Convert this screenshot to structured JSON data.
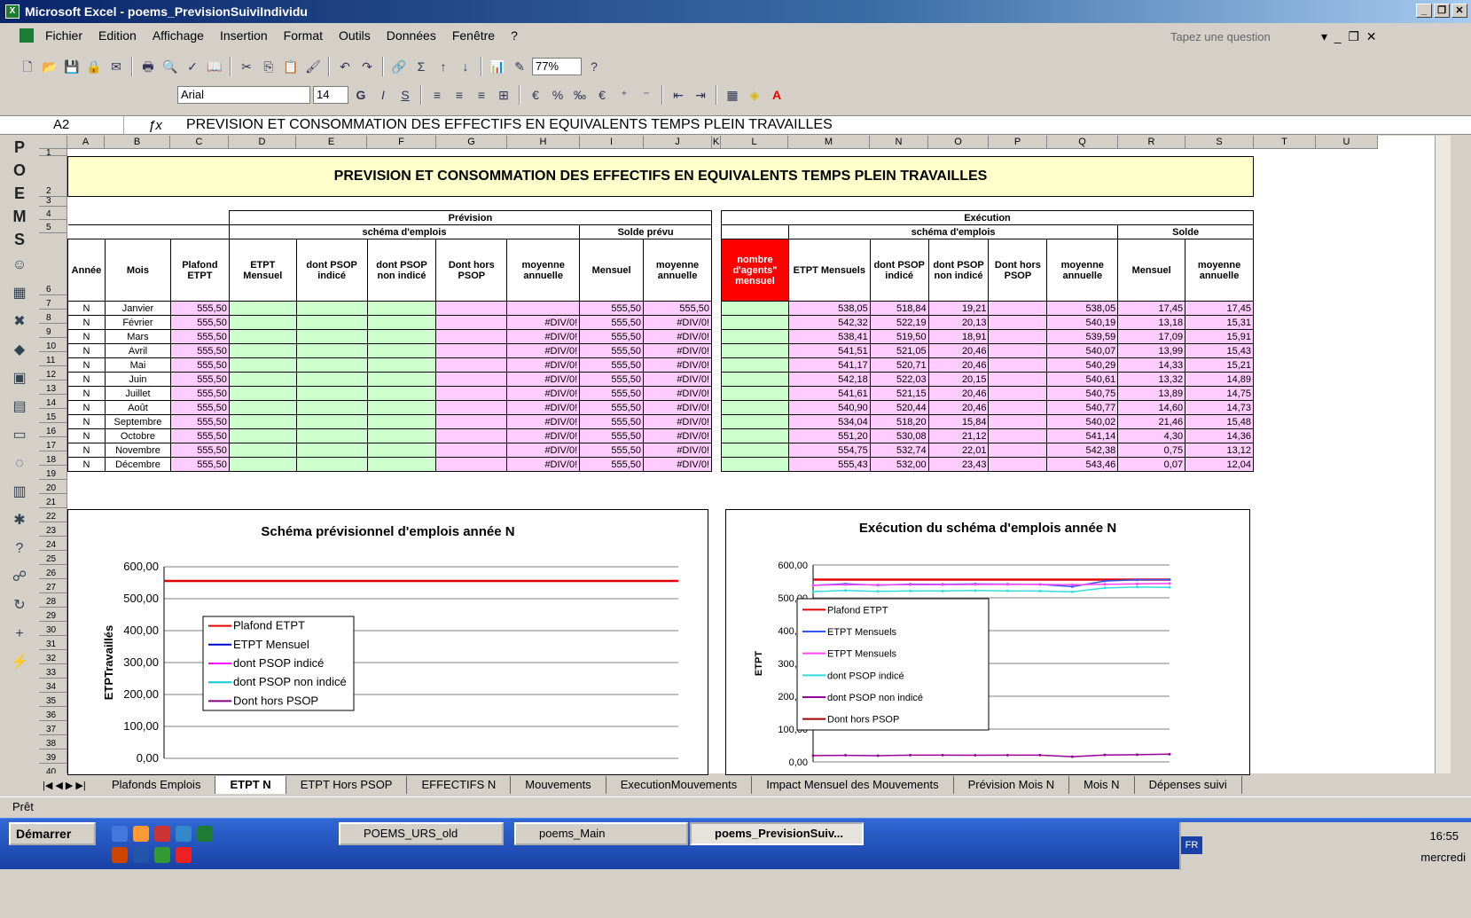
{
  "window": {
    "title": "Microsoft Excel - poems_PrevisionSuiviIndividu",
    "controls": [
      "_",
      "̆",
      "X"
    ]
  },
  "menubar": {
    "items": [
      "Fichier",
      "Edition",
      "Affichage",
      "Insertion",
      "Format",
      "Outils",
      "Données",
      "Fenêtre",
      "?"
    ],
    "help_placeholder": "Tapez une question"
  },
  "toolbar": {
    "zoom": "77%",
    "font": "Arial",
    "font_size": "14"
  },
  "formula_bar": {
    "cell_ref": "A2",
    "fx": "fx",
    "formula": "PREVISION ET CONSOMMATION DES EFFECTIFS EN EQUIVALENTS TEMPS PLEIN TRAVAILLES"
  },
  "sidebar": {
    "letters": [
      "P",
      "O",
      "E",
      "M",
      "S"
    ],
    "icons": [
      "smiley-icon",
      "table-icon",
      "tools-icon",
      "fox-icon",
      "save-icon",
      "save-as-icon",
      "window-icon",
      "search-icon",
      "calendar-icon",
      "settings-icon",
      "help-icon",
      "users-icon",
      "refresh-icon",
      "add-icon",
      "lightning-icon"
    ]
  },
  "columns": [
    "A",
    "B",
    "C",
    "D",
    "E",
    "F",
    "G",
    "H",
    "I",
    "J",
    "K",
    "L",
    "M",
    "N",
    "O",
    "P",
    "Q",
    "R",
    "S",
    "T",
    "U"
  ],
  "rows": [
    "1",
    "2",
    "3",
    "4",
    "5",
    "6",
    "7",
    "8",
    "9",
    "10",
    "11",
    "12",
    "13",
    "14",
    "15",
    "16",
    "17",
    "18",
    "19",
    "20",
    "21",
    "22",
    "23",
    "24",
    "25",
    "26",
    "27",
    "28",
    "29",
    "30",
    "31",
    "32",
    "33",
    "34",
    "35",
    "36",
    "37",
    "38",
    "39",
    "40"
  ],
  "sheet": {
    "title": "PREVISION ET CONSOMMATION DES EFFECTIFS EN EQUIVALENTS TEMPS PLEIN TRAVAILLES",
    "prevision": {
      "group": "Prévision",
      "subgroup1": "schéma d'emplois",
      "subgroup2": "Solde prévu",
      "headers": [
        "Année",
        "Mois",
        "Plafond ETPT",
        "ETPT Mensuel",
        "dont PSOP indicé",
        "dont PSOP non indicé",
        "Dont hors PSOP",
        "moyenne annuelle",
        "Mensuel",
        "moyenne annuelle"
      ],
      "rows": [
        [
          "N",
          "Janvier",
          "555,50",
          "",
          "",
          "",
          "",
          "",
          "555,50",
          "555,50"
        ],
        [
          "N",
          "Février",
          "555,50",
          "",
          "",
          "",
          "",
          "#DIV/0!",
          "555,50",
          "#DIV/0!"
        ],
        [
          "N",
          "Mars",
          "555,50",
          "",
          "",
          "",
          "",
          "#DIV/0!",
          "555,50",
          "#DIV/0!"
        ],
        [
          "N",
          "Avril",
          "555,50",
          "",
          "",
          "",
          "",
          "#DIV/0!",
          "555,50",
          "#DIV/0!"
        ],
        [
          "N",
          "Mai",
          "555,50",
          "",
          "",
          "",
          "",
          "#DIV/0!",
          "555,50",
          "#DIV/0!"
        ],
        [
          "N",
          "Juin",
          "555,50",
          "",
          "",
          "",
          "",
          "#DIV/0!",
          "555,50",
          "#DIV/0!"
        ],
        [
          "N",
          "Juillet",
          "555,50",
          "",
          "",
          "",
          "",
          "#DIV/0!",
          "555,50",
          "#DIV/0!"
        ],
        [
          "N",
          "Août",
          "555,50",
          "",
          "",
          "",
          "",
          "#DIV/0!",
          "555,50",
          "#DIV/0!"
        ],
        [
          "N",
          "Septembre",
          "555,50",
          "",
          "",
          "",
          "",
          "#DIV/0!",
          "555,50",
          "#DIV/0!"
        ],
        [
          "N",
          "Octobre",
          "555,50",
          "",
          "",
          "",
          "",
          "#DIV/0!",
          "555,50",
          "#DIV/0!"
        ],
        [
          "N",
          "Novembre",
          "555,50",
          "",
          "",
          "",
          "",
          "#DIV/0!",
          "555,50",
          "#DIV/0!"
        ],
        [
          "N",
          "Décembre",
          "555,50",
          "",
          "",
          "",
          "",
          "#DIV/0!",
          "555,50",
          "#DIV/0!"
        ]
      ]
    },
    "execution": {
      "group": "Exécution",
      "subgroup1": "schéma d'emplois",
      "subgroup2": "Solde",
      "headers": [
        "nombre d'agents\" mensuel",
        "ETPT Mensuels",
        "dont PSOP indicé",
        "dont PSOP non indicé",
        "Dont hors PSOP",
        "moyenne annuelle",
        "Mensuel",
        "moyenne annuelle"
      ],
      "rows": [
        [
          "",
          "538,05",
          "518,84",
          "19,21",
          "",
          "538,05",
          "17,45",
          "17,45"
        ],
        [
          "",
          "542,32",
          "522,19",
          "20,13",
          "",
          "540,19",
          "13,18",
          "15,31"
        ],
        [
          "",
          "538,41",
          "519,50",
          "18,91",
          "",
          "539,59",
          "17,09",
          "15,91"
        ],
        [
          "",
          "541,51",
          "521,05",
          "20,46",
          "",
          "540,07",
          "13,99",
          "15,43"
        ],
        [
          "",
          "541,17",
          "520,71",
          "20,46",
          "",
          "540,29",
          "14,33",
          "15,21"
        ],
        [
          "",
          "542,18",
          "522,03",
          "20,15",
          "",
          "540,61",
          "13,32",
          "14,89"
        ],
        [
          "",
          "541,61",
          "521,15",
          "20,46",
          "",
          "540,75",
          "13,89",
          "14,75"
        ],
        [
          "",
          "540,90",
          "520,44",
          "20,46",
          "",
          "540,77",
          "14,60",
          "14,73"
        ],
        [
          "",
          "534,04",
          "518,20",
          "15,84",
          "",
          "540,02",
          "21,46",
          "15,48"
        ],
        [
          "",
          "551,20",
          "530,08",
          "21,12",
          "",
          "541,14",
          "4,30",
          "14,36"
        ],
        [
          "",
          "554,75",
          "532,74",
          "22,01",
          "",
          "542,38",
          "0,75",
          "13,12"
        ],
        [
          "",
          "555,43",
          "532,00",
          "23,43",
          "",
          "543,46",
          "0,07",
          "12,04"
        ]
      ]
    }
  },
  "chart_data": [
    {
      "type": "line",
      "title": "Schéma prévisionnel d'emplois année N",
      "ylabel": "ETPTravaillés",
      "ylim": [
        0,
        600
      ],
      "yticks": [
        "600,00",
        "500,00",
        "400,00",
        "300,00",
        "200,00",
        "100,00",
        "0,00"
      ],
      "series": [
        {
          "name": "Plafond ETPT",
          "values": [
            555.5,
            555.5,
            555.5,
            555.5,
            555.5,
            555.5,
            555.5,
            555.5,
            555.5,
            555.5,
            555.5,
            555.5
          ],
          "color": "#e00000"
        },
        {
          "name": "ETPT Mensuel",
          "values": [],
          "color": "#0000cc"
        },
        {
          "name": "dont PSOP indicé",
          "values": [],
          "color": "#ff00ff"
        },
        {
          "name": "dont PSOP non indicé",
          "values": [],
          "color": "#00cccc"
        },
        {
          "name": "Dont hors PSOP",
          "values": [],
          "color": "#800080"
        }
      ]
    },
    {
      "type": "line",
      "title": "Exécution du schéma d'emplois année N",
      "ylabel": "ETPT",
      "ylim": [
        0,
        600
      ],
      "yticks": [
        "600,00",
        "500,00",
        "400,00",
        "300,00",
        "200,00",
        "100,00",
        "0,00"
      ],
      "series": [
        {
          "name": "Plafond ETPT",
          "values": [
            555.5,
            555.5,
            555.5,
            555.5,
            555.5,
            555.5,
            555.5,
            555.5,
            555.5,
            555.5,
            555.5,
            555.5
          ],
          "color": "#e00000"
        },
        {
          "name": "ETPT Mensuels",
          "values": [
            538.05,
            542.32,
            538.41,
            541.51,
            541.17,
            542.18,
            541.61,
            540.9,
            534.04,
            551.2,
            554.75,
            555.43
          ],
          "color": "#3355ff"
        },
        {
          "name": "ETPT Mensuels",
          "values": [
            538.05,
            540.19,
            539.59,
            540.07,
            540.29,
            540.61,
            540.75,
            540.77,
            540.02,
            541.14,
            542.38,
            543.46
          ],
          "color": "#ff44ff"
        },
        {
          "name": "dont PSOP indicé",
          "values": [
            518.84,
            522.19,
            519.5,
            521.05,
            520.71,
            522.03,
            521.15,
            520.44,
            518.2,
            530.08,
            532.74,
            532.0
          ],
          "color": "#33dddd"
        },
        {
          "name": "dont PSOP non indicé",
          "values": [
            19.21,
            20.13,
            18.91,
            20.46,
            20.46,
            20.15,
            20.46,
            20.46,
            15.84,
            21.12,
            22.01,
            23.43
          ],
          "color": "#990099"
        },
        {
          "name": "Dont hors PSOP",
          "values": [],
          "color": "#990000"
        }
      ]
    }
  ],
  "tabs": [
    "Plafonds Emplois",
    "ETPT N",
    "ETPT Hors PSOP",
    "EFFECTIFS N",
    "Mouvements",
    "ExecutionMouvements",
    "Impact Mensuel des Mouvements",
    "Prévision Mois N",
    "Mois N",
    "Dépenses suivi"
  ],
  "active_tab": "ETPT N",
  "status": "Prêt",
  "taskbar": {
    "start": "Démarrer",
    "tasks": [
      "POEMS_URS_old",
      "poems_Main",
      "poems_PrevisionSuiv..."
    ],
    "lang": "FR",
    "time": "16:55",
    "day": "mercredi"
  }
}
